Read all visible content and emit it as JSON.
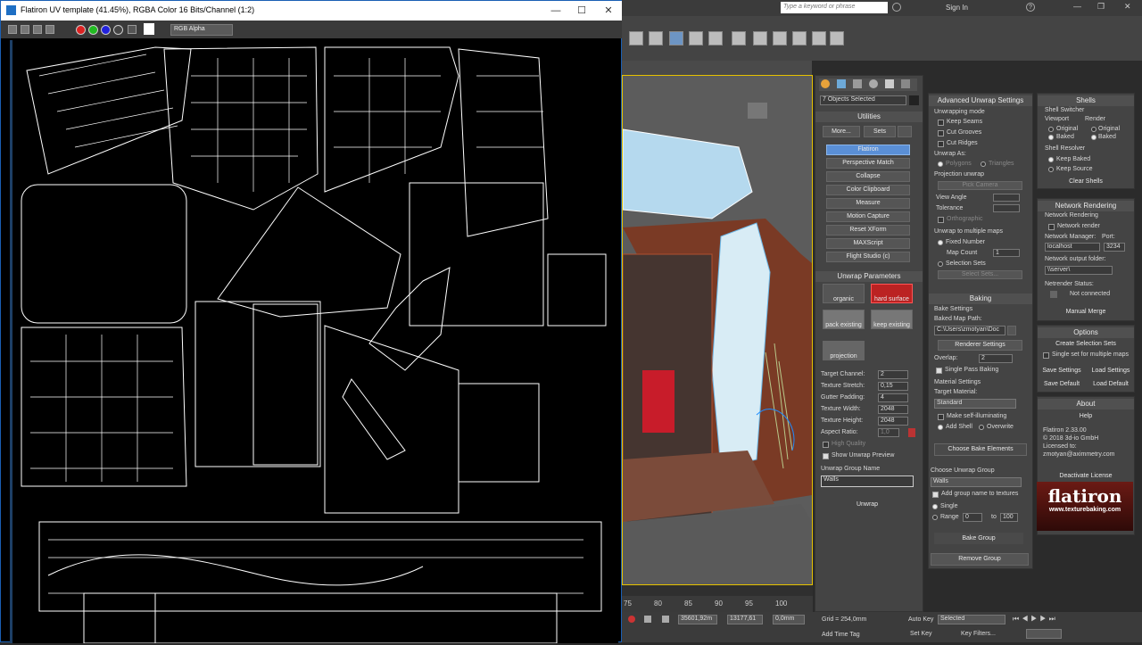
{
  "vfb": {
    "title": "Flatiron UV template (41.45%), RGBA Color 16 Bits/Channel (1:2)",
    "channel_select": "RGB Alpha",
    "minimize": "—",
    "maximize": "☐",
    "close": "✕"
  },
  "max": {
    "search_placeholder": "Type a keyword or phrase",
    "sign_in": "Sign In",
    "timeline_ticks": [
      "75",
      "80",
      "85",
      "90",
      "95",
      "100"
    ]
  },
  "utilities": {
    "objects_selected": "7 Objects Selected",
    "header": "Utilities",
    "more": "More...",
    "sets": "Sets",
    "items": [
      "Flatiron",
      "Perspective Match",
      "Collapse",
      "Color Clipboard",
      "Measure",
      "Motion Capture",
      "Reset XForm",
      "MAXScript",
      "Flight Studio (c)"
    ]
  },
  "unwrap": {
    "header": "Unwrap Parameters",
    "presets": [
      "organic",
      "hard surface",
      "pack existing",
      "keep existing",
      "projection"
    ],
    "target_channel_label": "Target Channel:",
    "target_channel": "2",
    "texture_stretch_label": "Texture Stretch:",
    "texture_stretch": "0,15",
    "gutter_padding_label": "Gutter Padding:",
    "gutter_padding": "4",
    "texture_width_label": "Texture Width:",
    "texture_width": "2048",
    "texture_height_label": "Texture Height:",
    "texture_height": "2048",
    "aspect_ratio_label": "Aspect Ratio:",
    "aspect_ratio": "1,0",
    "high_quality": "High Quality",
    "show_preview": "Show Unwrap Preview",
    "group_name_label": "Unwrap Group Name",
    "group_name": "Walls",
    "unwrap_button": "Unwrap"
  },
  "advanced": {
    "header": "Advanced Unwrap Settings",
    "mode_label": "Unwrapping mode",
    "keep_seams": "Keep Seams",
    "cut_grooves": "Cut Grooves",
    "cut_ridges": "Cut Ridges",
    "unwrap_as": "Unwrap As:",
    "polygons": "Polygons",
    "triangles": "Triangles",
    "projection_unwrap": "Projection unwrap",
    "pick_camera": "Pick Camera",
    "view_angle": "View Angle",
    "tolerance": "Tolerance",
    "orthographic": "Orthographic",
    "multiple_maps": "Unwrap to multiple maps",
    "fixed_number": "Fixed Number",
    "map_count": "Map Count",
    "map_count_value": "1",
    "selection_sets": "Selection Sets",
    "select_sets": "Select Sets..."
  },
  "baking": {
    "header": "Baking",
    "bake_settings": "Bake Settings",
    "map_path_label": "Baked Map Path:",
    "map_path": "C:\\Users\\zmotyan\\Doc",
    "renderer_settings": "Renderer Settings",
    "overlap_label": "Overlap:",
    "overlap": "2",
    "single_pass": "Single Pass Baking",
    "material_settings": "Material Settings",
    "target_material_label": "Target Material:",
    "target_material": "Standard",
    "self_illum": "Make self-illuminating",
    "add_shell": "Add Shell",
    "overwrite": "Overwrite",
    "choose_elements": "Choose Bake Elements",
    "choose_group_label": "Choose Unwrap Group",
    "group": "Walls",
    "add_group_name": "Add group name to textures",
    "single": "Single",
    "range": "Range",
    "range_from": "0",
    "to": "to",
    "range_to": "100",
    "bake_group": "Bake Group",
    "remove_group": "Remove Group"
  },
  "shells": {
    "header": "Shells",
    "switcher": "Shell Switcher",
    "viewport": "Viewport",
    "render": "Render",
    "original": "Original",
    "baked": "Baked",
    "resolver": "Shell Resolver",
    "keep_baked": "Keep Baked",
    "keep_source": "Keep Source",
    "clear": "Clear Shells"
  },
  "network": {
    "header": "Network Rendering",
    "sub": "Network Rendering",
    "net_render": "Network render",
    "manager_label": "Network Manager:",
    "port_label": "Port:",
    "manager": "localhost",
    "port": "3234",
    "output_label": "Network output folder:",
    "output": "\\\\server\\",
    "status_label": "Netrender Status:",
    "status": "Not connected",
    "manual_merge": "Manual Merge"
  },
  "options": {
    "header": "Options",
    "create_sets": "Create Selection Sets",
    "single_set": "Single set for multiple maps",
    "save_settings": "Save Settings",
    "load_settings": "Load Settings",
    "save_default": "Save Default",
    "load_default": "Load Default"
  },
  "about": {
    "header": "About",
    "help": "Help",
    "version": "Flatiron 2.33.00",
    "copyright": "© 2018 3d-io GmbH",
    "licensed": "Licensed to:",
    "email": "zmotyan@aximmetry.com",
    "deactivate": "Deactivate License",
    "logo": "flatiron",
    "url": "www.texturebaking.com"
  },
  "status": {
    "x": "35601,92m",
    "y": "13177,61",
    "z": "0,0mm",
    "grid": "Grid = 254,0mm",
    "auto_key": "Auto Key",
    "selected": "Selected",
    "set_key": "Set Key",
    "key_filters": "Key Filters...",
    "add_time_tag": "Add Time Tag"
  }
}
